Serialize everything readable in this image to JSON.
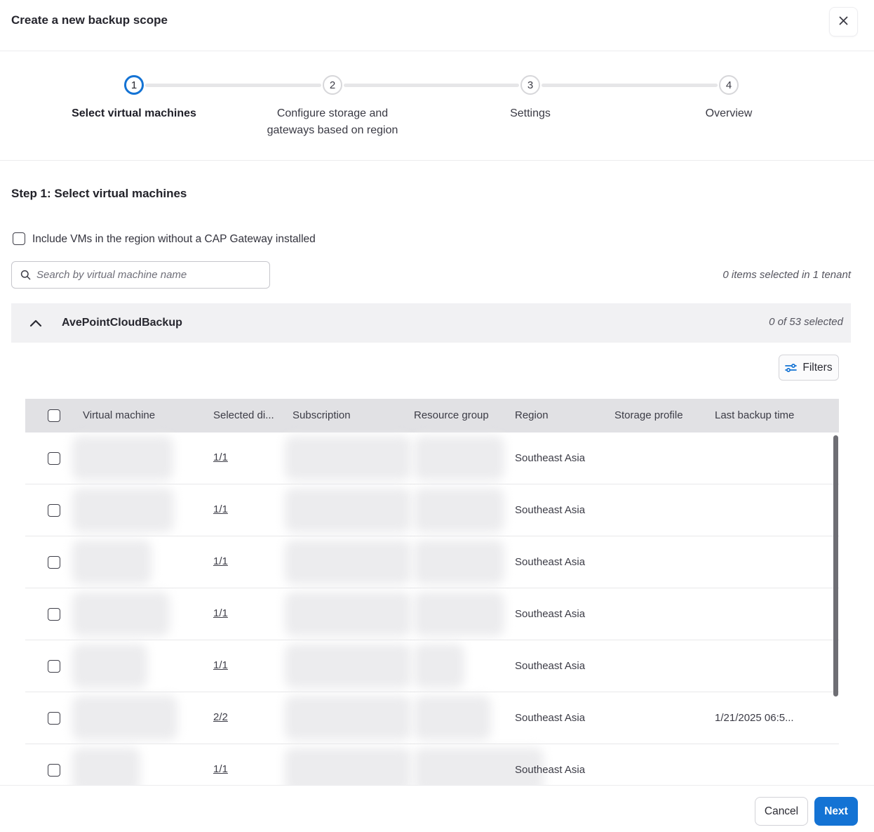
{
  "modal": {
    "title": "Create a new backup scope"
  },
  "stepper": {
    "steps": [
      {
        "number": "1",
        "label": "Select virtual machines"
      },
      {
        "number": "2",
        "label": "Configure storage and gateways based on region"
      },
      {
        "number": "3",
        "label": "Settings"
      },
      {
        "number": "4",
        "label": "Overview"
      }
    ]
  },
  "step1": {
    "heading": "Step 1: Select virtual machines",
    "include_vms_label": "Include VMs in the region without a CAP Gateway installed",
    "search_placeholder": "Search by virtual machine name",
    "selection_summary": "0 items selected in 1 tenant"
  },
  "tenant": {
    "name": "AvePointCloudBackup",
    "selection_summary": "0 of 53 selected",
    "filters_label": "Filters"
  },
  "table": {
    "columns": [
      "Virtual machine",
      "Selected di...",
      "Subscription",
      "Resource group",
      "Region",
      "Storage profile",
      "Last backup time"
    ],
    "rows": [
      {
        "selected_disks": "1/1",
        "region": "Southeast Asia",
        "last_backup": ""
      },
      {
        "selected_disks": "1/1",
        "region": "Southeast Asia",
        "last_backup": ""
      },
      {
        "selected_disks": "1/1",
        "region": "Southeast Asia",
        "last_backup": ""
      },
      {
        "selected_disks": "1/1",
        "region": "Southeast Asia",
        "last_backup": ""
      },
      {
        "selected_disks": "1/1",
        "region": "Southeast Asia",
        "last_backup": ""
      },
      {
        "selected_disks": "2/2",
        "region": "Southeast Asia",
        "last_backup": "1/21/2025 06:5..."
      },
      {
        "selected_disks": "1/1",
        "region": "Southeast Asia",
        "last_backup": ""
      }
    ]
  },
  "footer": {
    "cancel_label": "Cancel",
    "next_label": "Next"
  },
  "colors": {
    "accent_blue": "#1473d4",
    "header_gray": "#e1e1e4",
    "accordion_gray": "#f1f1f3"
  }
}
